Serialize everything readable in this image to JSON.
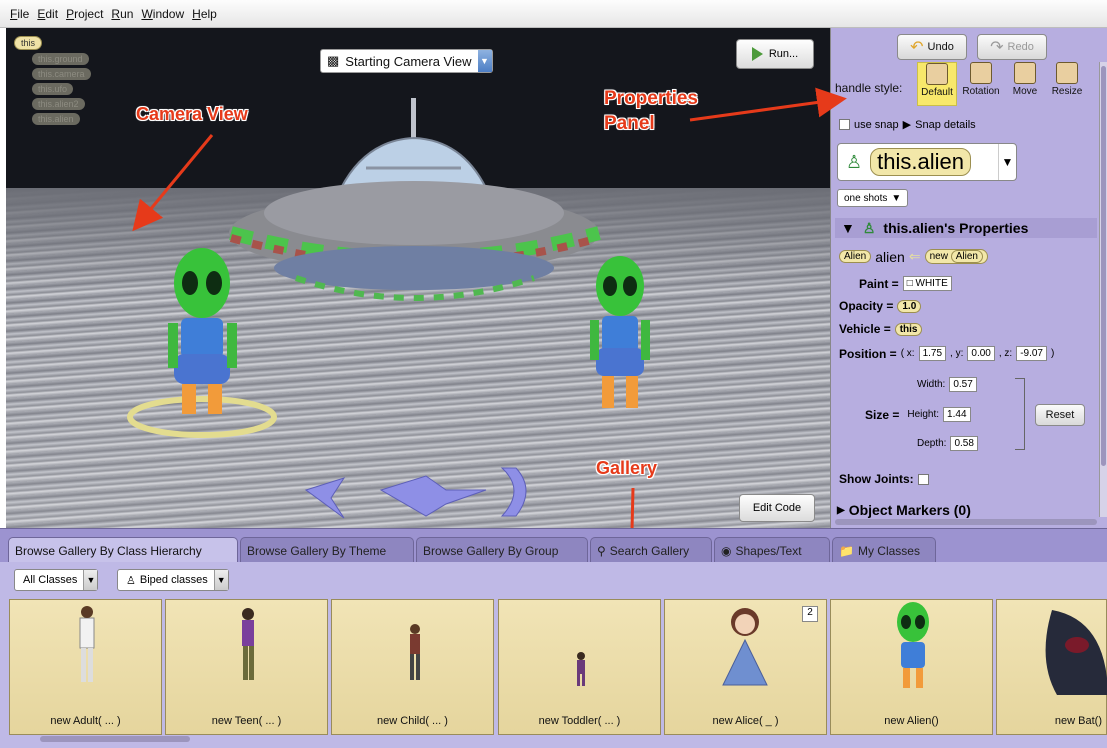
{
  "menu": [
    "File",
    "Edit",
    "Project",
    "Run",
    "Window",
    "Help"
  ],
  "scene": {
    "tree_root": "this",
    "tree_items": [
      "this.ground",
      "this.camera",
      "this.ufo",
      "this.alien2",
      "this.alien"
    ],
    "camera_view": "Starting Camera View",
    "run_label": "Run...",
    "edit_code_label": "Edit Code"
  },
  "callouts": {
    "camera": "Camera View",
    "properties_1": "Properties",
    "properties_2": "Panel",
    "gallery": "Gallery"
  },
  "panel": {
    "undo": "Undo",
    "redo": "Redo",
    "handle_style_label": "handle style:",
    "handles": [
      "Default",
      "Rotation",
      "Move",
      "Resize"
    ],
    "use_snap": "use snap",
    "snap_details": "Snap details",
    "selected_object": "this.alien",
    "one_shots": "one shots",
    "properties_header": "this.alien's Properties",
    "class_name": "Alien",
    "var_name": "alien",
    "new_kw": "new",
    "ctor": "Alien",
    "paint_label": "Paint =",
    "paint_value": "WHITE",
    "opacity_label": "Opacity =",
    "opacity_value": "1.0",
    "vehicle_label": "Vehicle =",
    "vehicle_value": "this",
    "position_label": "Position =",
    "pos_x": "1.75",
    "pos_y": "0.00",
    "pos_z": "-9.07",
    "x_label": "( x:",
    "y_label": ", y:",
    "z_label": ", z:",
    "close_paren": ")",
    "size_label": "Size =",
    "width_label": "Width:",
    "width": "0.57",
    "height_label": "Height:",
    "height": "1.44",
    "depth_label": "Depth:",
    "depth": "0.58",
    "reset": "Reset",
    "show_joints": "Show Joints:",
    "object_markers": "Object Markers (0)"
  },
  "gallery": {
    "tabs": [
      "Browse Gallery By Class Hierarchy",
      "Browse Gallery By Theme",
      "Browse Gallery By Group",
      "Search Gallery",
      "Shapes/Text",
      "My Classes"
    ],
    "all_classes": "All Classes",
    "biped_classes": "Biped classes",
    "tiles": [
      "new Adult( ... )",
      "new Teen( ... )",
      "new Child( ... )",
      "new Toddler( ... )",
      "new Alice( _ )",
      "new Alien()",
      "new Bat()"
    ],
    "alice_badge": "2"
  }
}
